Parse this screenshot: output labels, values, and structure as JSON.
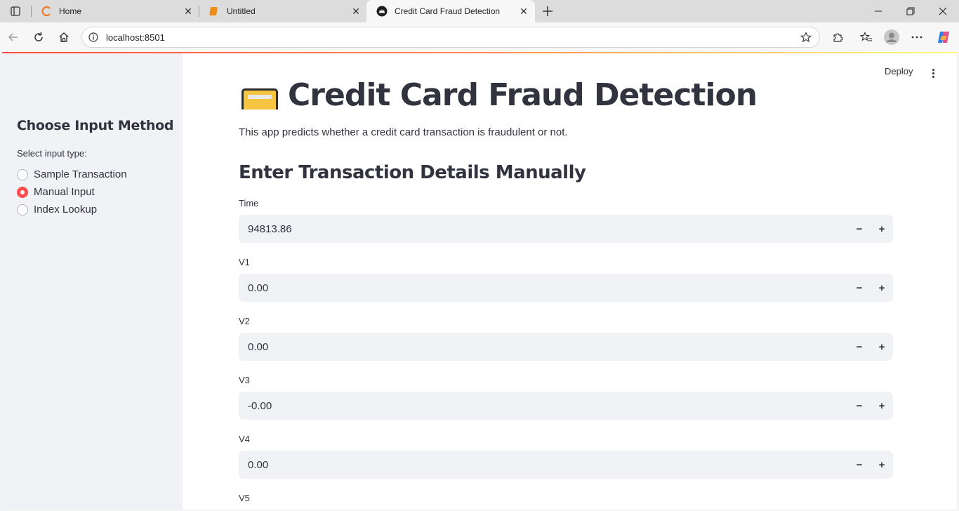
{
  "browser": {
    "tabs": [
      {
        "title": "Home",
        "active": false
      },
      {
        "title": "Untitled",
        "active": false
      },
      {
        "title": "Credit Card Fraud Detection",
        "active": true
      }
    ],
    "url": "localhost:8501"
  },
  "header": {
    "deploy_label": "Deploy"
  },
  "sidebar": {
    "heading": "Choose Input Method",
    "radio_label": "Select input type:",
    "options": [
      {
        "label": "Sample Transaction",
        "selected": false
      },
      {
        "label": "Manual Input",
        "selected": true
      },
      {
        "label": "Index Lookup",
        "selected": false
      }
    ]
  },
  "main": {
    "title": "Credit Card Fraud Detection",
    "description": "This app predicts whether a credit card transaction is fraudulent or not.",
    "section_title": "Enter Transaction Details Manually",
    "fields": [
      {
        "label": "Time",
        "value": "94813.86"
      },
      {
        "label": "V1",
        "value": "0.00"
      },
      {
        "label": "V2",
        "value": "0.00"
      },
      {
        "label": "V3",
        "value": "-0.00"
      },
      {
        "label": "V4",
        "value": "0.00"
      },
      {
        "label": "V5",
        "value": ""
      }
    ]
  },
  "colors": {
    "accent": "#ff4b4b",
    "sidebar_bg": "#f0f2f6",
    "text": "#31333f"
  }
}
